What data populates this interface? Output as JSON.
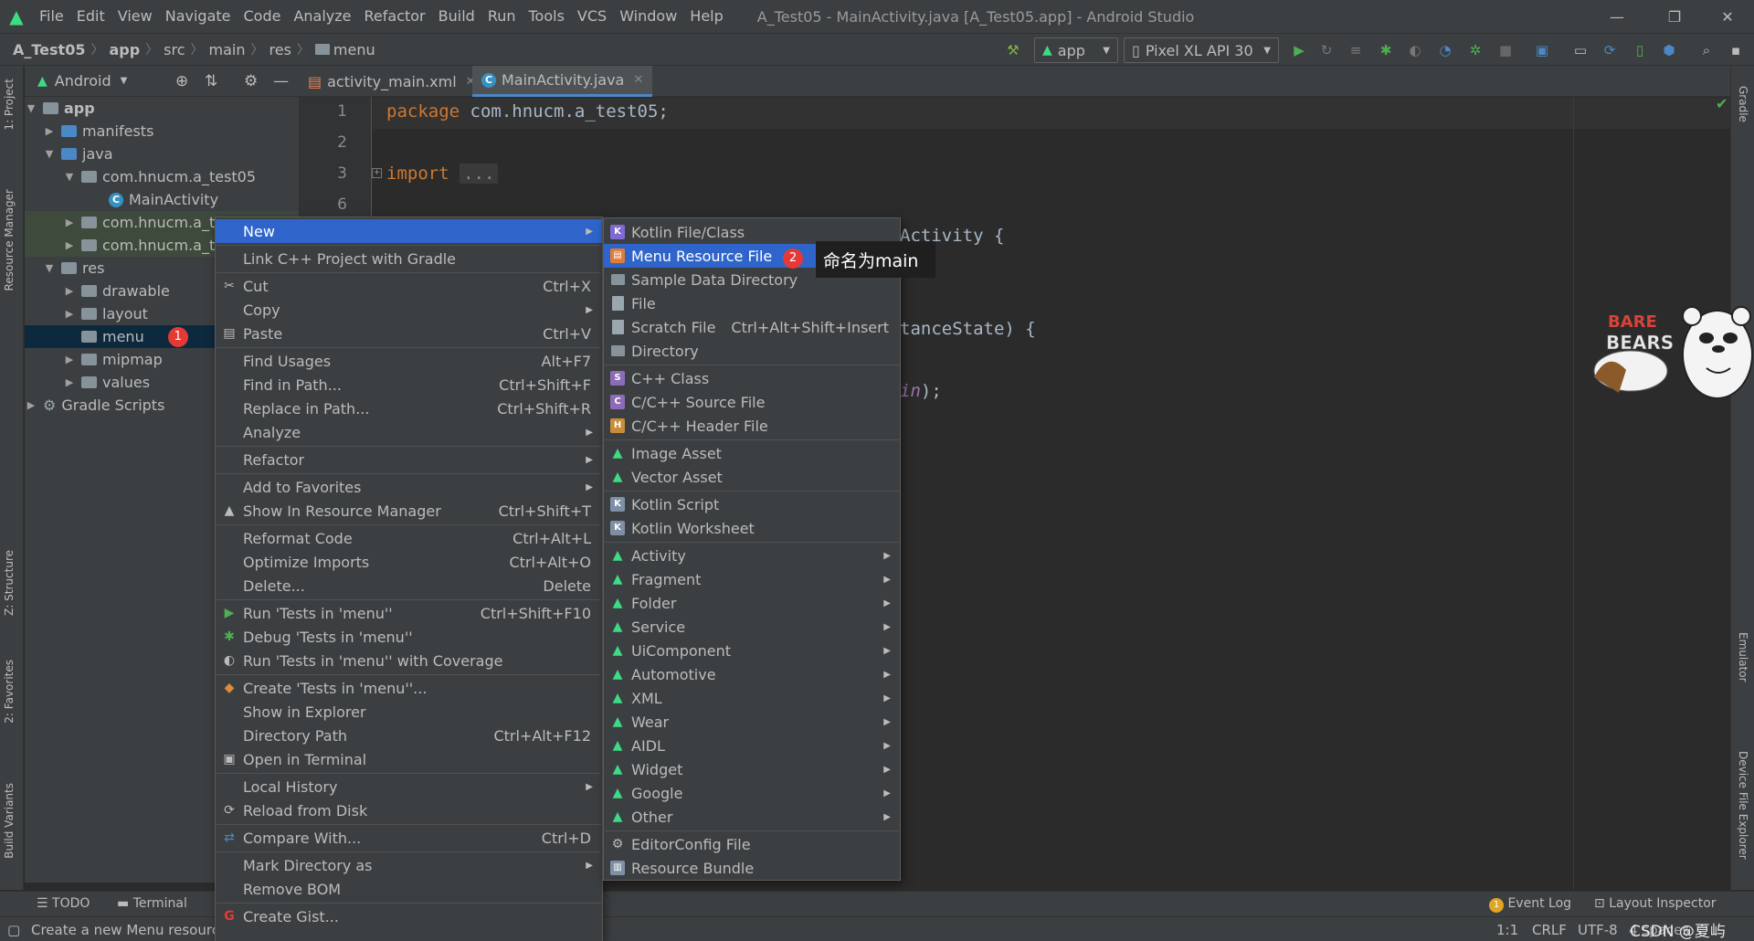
{
  "app_title": "A_Test05 - MainActivity.java [A_Test05.app] - Android Studio",
  "menubar": [
    "File",
    "Edit",
    "View",
    "Navigate",
    "Code",
    "Analyze",
    "Refactor",
    "Build",
    "Run",
    "Tools",
    "VCS",
    "Window",
    "Help"
  ],
  "breadcrumb": [
    "A_Test05",
    "app",
    "src",
    "main",
    "res",
    "menu"
  ],
  "toolbar": {
    "run_config": "app",
    "device": "Pixel XL API 30"
  },
  "project_panel": {
    "view_mode": "Android",
    "tree": [
      {
        "label": "app",
        "level": 0,
        "expanded": true
      },
      {
        "label": "manifests",
        "level": 1
      },
      {
        "label": "java",
        "level": 1,
        "expanded": true
      },
      {
        "label": "com.hnucm.a_test05",
        "level": 2,
        "expanded": true
      },
      {
        "label": "MainActivity",
        "level": 3
      },
      {
        "label": "com.hnucm.a_te",
        "level": 2
      },
      {
        "label": "com.hnucm.a_te",
        "level": 2
      },
      {
        "label": "res",
        "level": 1,
        "expanded": true
      },
      {
        "label": "drawable",
        "level": 2
      },
      {
        "label": "layout",
        "level": 2
      },
      {
        "label": "menu",
        "level": 2,
        "selected": true
      },
      {
        "label": "mipmap",
        "level": 2
      },
      {
        "label": "values",
        "level": 2
      },
      {
        "label": "Gradle Scripts",
        "level": 0
      }
    ]
  },
  "editor": {
    "tabs": [
      "activity_main.xml",
      "MainActivity.java"
    ],
    "active_tab": "MainActivity.java",
    "line_numbers": [
      "1",
      "2",
      "3",
      "6"
    ],
    "code": {
      "l1_kw": "package",
      "l1_rest": " com.hnucm.a_test05;",
      "l3_kw": "import",
      "l3_fold": "...",
      "frag1": "Activity {",
      "frag2": "tanceState) {",
      "frag3": "in",
      "frag3_rest": ");"
    }
  },
  "context_menu": {
    "items": [
      {
        "label": "New",
        "submenu": true,
        "selected": true
      },
      {
        "label": "Link C++ Project with Gradle"
      },
      {
        "label": "Cut",
        "shortcut": "Ctrl+X",
        "icon": "scissors-icon"
      },
      {
        "label": "Copy",
        "submenu": true
      },
      {
        "label": "Paste",
        "shortcut": "Ctrl+V",
        "icon": "clipboard-icon"
      },
      {
        "label": "Find Usages",
        "shortcut": "Alt+F7"
      },
      {
        "label": "Find in Path...",
        "shortcut": "Ctrl+Shift+F"
      },
      {
        "label": "Replace in Path...",
        "shortcut": "Ctrl+Shift+R"
      },
      {
        "label": "Analyze",
        "submenu": true
      },
      {
        "label": "Refactor",
        "submenu": true
      },
      {
        "label": "Add to Favorites",
        "submenu": true
      },
      {
        "label": "Show In Resource Manager",
        "shortcut": "Ctrl+Shift+T",
        "icon": "resource-manager-icon"
      },
      {
        "label": "Reformat Code",
        "shortcut": "Ctrl+Alt+L"
      },
      {
        "label": "Optimize Imports",
        "shortcut": "Ctrl+Alt+O"
      },
      {
        "label": "Delete...",
        "shortcut": "Delete"
      },
      {
        "label": "Run 'Tests in 'menu''",
        "shortcut": "Ctrl+Shift+F10",
        "icon": "run-icon"
      },
      {
        "label": "Debug 'Tests in 'menu''",
        "icon": "debug-icon"
      },
      {
        "label": "Run 'Tests in 'menu'' with Coverage",
        "icon": "coverage-icon"
      },
      {
        "label": "Create 'Tests in 'menu''...",
        "icon": "create-test-icon"
      },
      {
        "label": "Show in Explorer"
      },
      {
        "label": "Directory Path",
        "shortcut": "Ctrl+Alt+F12"
      },
      {
        "label": "Open in Terminal",
        "icon": "terminal-icon"
      },
      {
        "label": "Local History",
        "submenu": true
      },
      {
        "label": "Reload from Disk",
        "icon": "reload-icon"
      },
      {
        "label": "Compare With...",
        "shortcut": "Ctrl+D",
        "icon": "compare-icon"
      },
      {
        "label": "Mark Directory as",
        "submenu": true
      },
      {
        "label": "Remove BOM"
      },
      {
        "label": "Create Gist...",
        "icon": "gist-icon"
      }
    ]
  },
  "new_submenu": {
    "items": [
      {
        "label": "Kotlin File/Class"
      },
      {
        "label": "Menu Resource File",
        "selected": true
      },
      {
        "label": "Sample Data Directory"
      },
      {
        "label": "File"
      },
      {
        "label": "Scratch File",
        "shortcut": "Ctrl+Alt+Shift+Insert"
      },
      {
        "label": "Directory"
      },
      {
        "label": "C++ Class"
      },
      {
        "label": "C/C++ Source File"
      },
      {
        "label": "C/C++ Header File"
      },
      {
        "label": "Image Asset"
      },
      {
        "label": "Vector Asset"
      },
      {
        "label": "Kotlin Script"
      },
      {
        "label": "Kotlin Worksheet"
      },
      {
        "label": "Activity",
        "submenu": true
      },
      {
        "label": "Fragment",
        "submenu": true
      },
      {
        "label": "Folder",
        "submenu": true
      },
      {
        "label": "Service",
        "submenu": true
      },
      {
        "label": "UiComponent",
        "submenu": true
      },
      {
        "label": "Automotive",
        "submenu": true
      },
      {
        "label": "XML",
        "submenu": true
      },
      {
        "label": "Wear",
        "submenu": true
      },
      {
        "label": "AIDL",
        "submenu": true
      },
      {
        "label": "Widget",
        "submenu": true
      },
      {
        "label": "Google",
        "submenu": true
      },
      {
        "label": "Other",
        "submenu": true
      },
      {
        "label": "EditorConfig File"
      },
      {
        "label": "Resource Bundle"
      }
    ]
  },
  "annotations": {
    "badge1": "1",
    "badge2": "2",
    "tooltip": "命名为main"
  },
  "left_stripe": [
    "1: Project",
    "Resource Manager",
    "Z: Structure",
    "2: Favorites",
    "Build Variants"
  ],
  "right_stripe": [
    "Gradle",
    "Emulator",
    "Device File Explorer"
  ],
  "bottom_tabs": {
    "todo": "TODO",
    "terminal": "Terminal",
    "event_log": "Event Log",
    "event_count": "1",
    "layout_inspector": "Layout Inspector"
  },
  "status": {
    "message": "Create a new Menu resourc",
    "position": "1:1",
    "line_sep": "CRLF",
    "encoding": "UTF-8",
    "indent": "4 spaces",
    "watermark": "CSDN @夏屿"
  },
  "colors": {
    "accent": "#2f65ca",
    "android_green": "#3ddc84",
    "badge_red": "#e53935"
  }
}
